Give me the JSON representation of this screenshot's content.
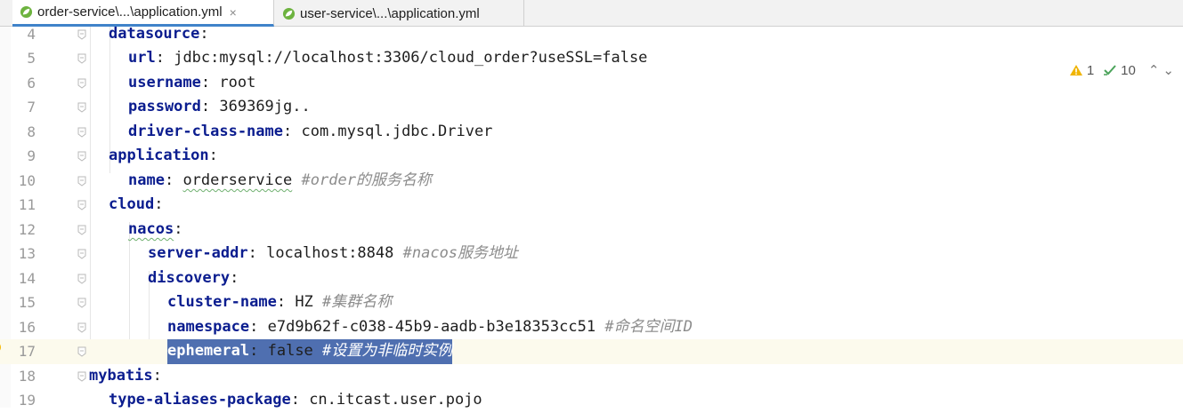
{
  "tabs": [
    {
      "label": "order-service\\...\\application.yml",
      "active": true,
      "icon": "spring-leaf-icon",
      "close": "×"
    },
    {
      "label": "user-service\\...\\application.yml",
      "active": false,
      "icon": "spring-leaf-icon"
    }
  ],
  "status": {
    "warnings": "1",
    "checks": "10"
  },
  "lines": [
    {
      "n": "4",
      "parts": [
        [
          "k",
          "datasource"
        ],
        [
          "p",
          ":"
        ]
      ]
    },
    {
      "n": "5",
      "parts": [
        [
          "k",
          "url"
        ],
        [
          "p",
          ": "
        ],
        [
          "v",
          "jdbc:mysql://localhost:3306/cloud_order?useSSL=false"
        ]
      ]
    },
    {
      "n": "6",
      "parts": [
        [
          "k",
          "username"
        ],
        [
          "p",
          ": "
        ],
        [
          "v",
          "root"
        ]
      ]
    },
    {
      "n": "7",
      "parts": [
        [
          "k",
          "password"
        ],
        [
          "p",
          ": "
        ],
        [
          "v",
          "369369jg.."
        ]
      ]
    },
    {
      "n": "8",
      "parts": [
        [
          "k",
          "driver-class-name"
        ],
        [
          "p",
          ": "
        ],
        [
          "v",
          "com.mysql.jdbc.Driver"
        ]
      ]
    },
    {
      "n": "9",
      "parts": [
        [
          "k",
          "application"
        ],
        [
          "p",
          ":"
        ]
      ]
    },
    {
      "n": "10",
      "parts": [
        [
          "k",
          "name"
        ],
        [
          "p",
          ": "
        ],
        [
          "v",
          "orderservice"
        ],
        [
          "p",
          " "
        ],
        [
          "c",
          "#order的服务名称"
        ]
      ]
    },
    {
      "n": "11",
      "parts": [
        [
          "k",
          "cloud"
        ],
        [
          "p",
          ":"
        ]
      ]
    },
    {
      "n": "12",
      "parts": [
        [
          "k",
          "nacos"
        ],
        [
          "p",
          ":"
        ]
      ]
    },
    {
      "n": "13",
      "parts": [
        [
          "k",
          "server-addr"
        ],
        [
          "p",
          ": "
        ],
        [
          "v",
          "localhost:8848"
        ],
        [
          "p",
          " "
        ],
        [
          "c",
          "#nacos服务地址"
        ]
      ]
    },
    {
      "n": "14",
      "parts": [
        [
          "k",
          "discovery"
        ],
        [
          "p",
          ":"
        ]
      ]
    },
    {
      "n": "15",
      "parts": [
        [
          "k",
          "cluster-name"
        ],
        [
          "p",
          ": "
        ],
        [
          "v",
          "HZ"
        ],
        [
          "p",
          " "
        ],
        [
          "c",
          "#集群名称"
        ]
      ]
    },
    {
      "n": "16",
      "parts": [
        [
          "k",
          "namespace"
        ],
        [
          "p",
          ": "
        ],
        [
          "v",
          "e7d9b62f-c038-45b9-aadb-b3e18353cc51"
        ],
        [
          "p",
          " "
        ],
        [
          "c",
          "#命名空间ID"
        ]
      ]
    },
    {
      "n": "17",
      "parts": [
        [
          "k",
          "ephemeral"
        ],
        [
          "p",
          ": "
        ],
        [
          "v",
          "false"
        ],
        [
          "p",
          " "
        ],
        [
          "c",
          "#设置为非临时实例"
        ]
      ]
    },
    {
      "n": "18",
      "parts": [
        [
          "k",
          "mybatis"
        ],
        [
          "p",
          ":"
        ]
      ]
    },
    {
      "n": "19",
      "parts": [
        [
          "k",
          "type-aliases-package"
        ],
        [
          "p",
          ": "
        ],
        [
          "v",
          "cn.itcast.user.pojo"
        ]
      ]
    }
  ]
}
